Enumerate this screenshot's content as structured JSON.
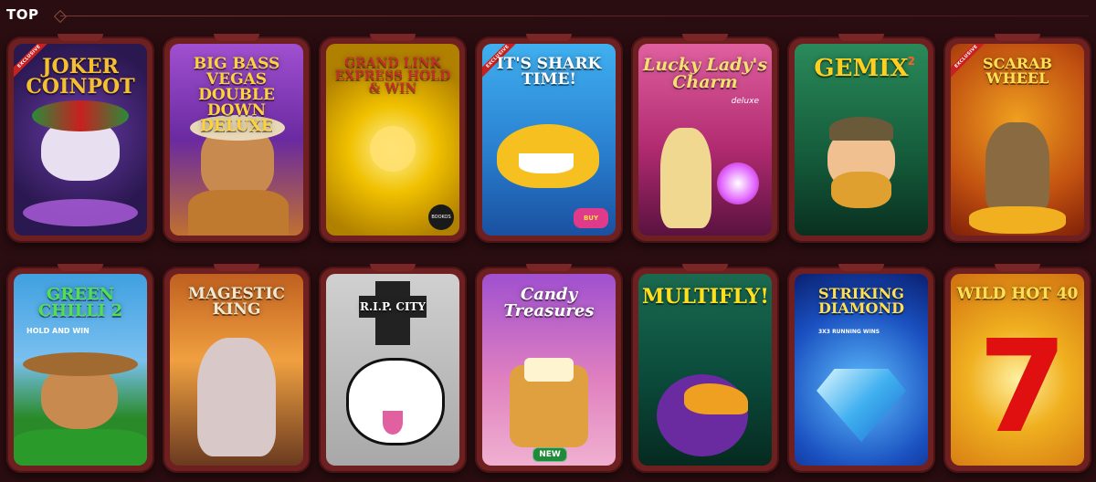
{
  "header": {
    "title": "TOP"
  },
  "games": [
    {
      "title": "JOKER COINPOT",
      "badge": "EXCLUSIVE"
    },
    {
      "title": "BIG BASS VEGAS DOUBLE DOWN DELUXE"
    },
    {
      "title": "GRAND LINK EXPRESS HOLD & WIN",
      "badge": "BOOKOS HUNT"
    },
    {
      "title": "IT'S SHARK TIME!",
      "badge": "EXCLUSIVE",
      "extra": "BUY BONUS"
    },
    {
      "title": "Lucky Lady's Charm",
      "subtitle": "deluxe"
    },
    {
      "title": "GEMIX",
      "subtitle": "2"
    },
    {
      "title": "SCARAB WHEEL",
      "badge": "EXCLUSIVE"
    },
    {
      "title": "GREEN CHILLI 2",
      "subtitle": "HOLD AND WIN"
    },
    {
      "title": "MAGESTIC KING"
    },
    {
      "title": "R.I.P. CITY"
    },
    {
      "title": "Candy Treasures",
      "badge": "NEW"
    },
    {
      "title": "MULTIFLY!"
    },
    {
      "title": "STRIKING DIAMOND",
      "subtitle": "3X3 RUNNING WINS"
    },
    {
      "title": "WILD HOT 40"
    }
  ]
}
